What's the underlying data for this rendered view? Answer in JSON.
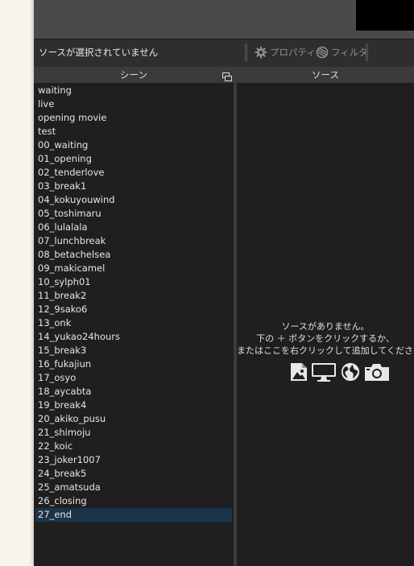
{
  "toolbar": {
    "no_source_text": "ソースが選択されていません",
    "properties_label": "プロパティ",
    "filters_label": "フィルタ"
  },
  "scenes": {
    "header": "シーン",
    "items": [
      "waiting",
      "live",
      "opening movie",
      "test",
      "00_waiting",
      "01_opening",
      "02_tenderlove",
      "03_break1",
      "04_kokuyouwind",
      "05_toshimaru",
      "06_lulalala",
      "07_lunchbreak",
      "08_betachelsea",
      "09_makicamel",
      "10_sylph01",
      "11_break2",
      "12_9sako6",
      "13_onk",
      "14_yukao24hours",
      "15_break3",
      "16_fukajiun",
      "17_osyo",
      "18_aycabta",
      "19_break4",
      "20_akiko_pusu",
      "21_shimoju",
      "22_koic",
      "23_joker1007",
      "24_break5",
      "25_amatsuda",
      "26_closing",
      "27_end"
    ],
    "selected": "27_end"
  },
  "sources": {
    "header": "ソース",
    "empty_line1": "ソースがありません。",
    "empty_line2": "下の ＋ ボタンをクリックするか、",
    "empty_line3": "またはここを右クリックして追加してください。",
    "icons": [
      "image-icon",
      "display-capture-icon",
      "browser-globe-icon",
      "camera-icon"
    ]
  }
}
